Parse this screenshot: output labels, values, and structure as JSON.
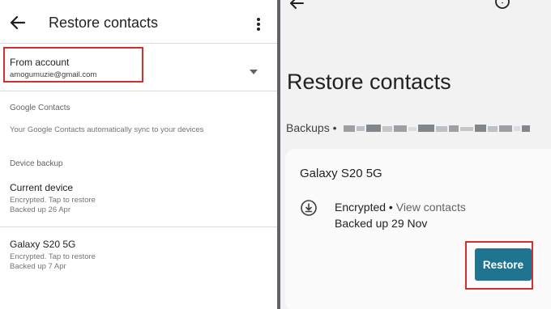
{
  "left": {
    "title": "Restore contacts",
    "account": {
      "label": "From account",
      "email": "amogumuzie@gmail.com"
    },
    "google_contacts": {
      "heading": "Google Contacts",
      "description": "Your Google Contacts automatically sync to your devices"
    },
    "device_backup": {
      "heading": "Device backup",
      "items": [
        {
          "name": "Current device",
          "status": "Encrypted. Tap to restore",
          "backed_up": "Backed up 26 Apr"
        },
        {
          "name": "Galaxy S20 5G",
          "status": "Encrypted. Tap to restore",
          "backed_up": "Backed up 7 Apr"
        }
      ]
    }
  },
  "right": {
    "title": "Restore contacts",
    "backups_label": "Backups •",
    "card": {
      "device": "Galaxy S20 5G",
      "encrypted": "Encrypted",
      "separator": " • ",
      "view_contacts": "View contacts",
      "backed_up": "Backed up 29 Nov",
      "restore_label": "Restore"
    }
  },
  "icons": {
    "back": "back-arrow-icon",
    "more": "more-vert-icon",
    "dropdown": "arrow-drop-down-icon",
    "help": "help-icon",
    "download": "download-circle-icon"
  },
  "colors": {
    "highlight_border": "#d32f2f",
    "restore_button": "#1f7590",
    "divider": "#dadce0"
  }
}
